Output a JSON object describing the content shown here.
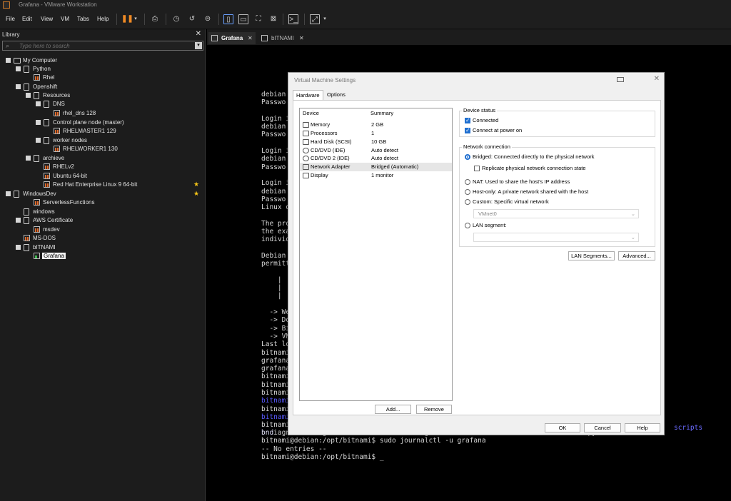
{
  "window": {
    "title": "Grafana - VMware Workstation"
  },
  "menu": [
    "File",
    "Edit",
    "View",
    "VM",
    "Tabs",
    "Help"
  ],
  "library": {
    "title": "Library",
    "search_placeholder": "Type here to search",
    "tree": [
      {
        "label": "My Computer"
      },
      {
        "label": "Python"
      },
      {
        "label": "Rhel"
      },
      {
        "label": "Openshift"
      },
      {
        "label": "Resources"
      },
      {
        "label": "DNS"
      },
      {
        "label": "rhel_dns 128"
      },
      {
        "label": "Control plane node (master)"
      },
      {
        "label": "RHELMASTER1 129"
      },
      {
        "label": "worker nodes"
      },
      {
        "label": "RHELWORKER1 130"
      },
      {
        "label": "archieve"
      },
      {
        "label": "RHELv2"
      },
      {
        "label": "Ubuntu 64-bit"
      },
      {
        "label": "Red Hat Enterprise Linux 9 64-bit"
      },
      {
        "label": "WindowsDev"
      },
      {
        "label": "ServerlessFunctions"
      },
      {
        "label": "windows"
      },
      {
        "label": "AWS Certificate"
      },
      {
        "label": "msdev"
      },
      {
        "label": "MS-DOS"
      },
      {
        "label": "bITNAMI"
      },
      {
        "label": "Grafana"
      }
    ]
  },
  "tabs": [
    {
      "label": "Grafana"
    },
    {
      "label": "bITNAMI"
    }
  ],
  "terminal": {
    "lines": [
      "debian",
      "Passwo",
      "",
      "Login i",
      "debian",
      "Passwo",
      "",
      "Login i",
      "debian",
      "Passwo",
      "",
      "Login i",
      "debian",
      "Passwo",
      "Linux d",
      "",
      "The pro",
      "the exa",
      "individ",
      "",
      "Debian",
      "permitt",
      "",
      "    |",
      "    |",
      "    |",
      "",
      "  -> We",
      "  -> Do",
      "  -> Bi",
      "  -> VM",
      "Last lo",
      "bitnami",
      "grafana",
      "grafana",
      "bitnami",
      "bitnami",
      "bitnami",
      "bitnami",
      "bitnami",
      "bitnami",
      "bitnami",
      "bnd"
    ],
    "tail": [
      "bndiagnostic-regex.ini   common         grafana        licenses         node    python",
      "bitnami@debian:/opt/bitnami$ sudo journalctl -u grafana",
      "-- No entries --",
      "bitnami@debian:/opt/bitnami$ _"
    ],
    "scripts_label": "scripts"
  },
  "dialog": {
    "title": "Virtual Machine Settings",
    "tabs": [
      "Hardware",
      "Options"
    ],
    "device_header": "Device",
    "summary_header": "Summary",
    "devices": [
      {
        "name": "Memory",
        "summary": "2 GB"
      },
      {
        "name": "Processors",
        "summary": "1"
      },
      {
        "name": "Hard Disk (SCSI)",
        "summary": "10 GB"
      },
      {
        "name": "CD/DVD (IDE)",
        "summary": "Auto detect"
      },
      {
        "name": "CD/DVD 2 (IDE)",
        "summary": "Auto detect"
      },
      {
        "name": "Network Adapter",
        "summary": "Bridged (Automatic)"
      },
      {
        "name": "Display",
        "summary": "1 monitor"
      }
    ],
    "add_label": "Add...",
    "remove_label": "Remove",
    "device_status": {
      "title": "Device status",
      "connected": "Connected",
      "connect_power": "Connect at power on"
    },
    "network": {
      "title": "Network connection",
      "bridged": "Bridged: Connected directly to the physical network",
      "replicate": "Replicate physical network connection state",
      "nat": "NAT: Used to share the host's IP address",
      "hostonly": "Host-only: A private network shared with the host",
      "custom": "Custom: Specific virtual network",
      "vmnet": "VMnet0",
      "lan": "LAN segment:",
      "lan_segments_btn": "LAN Segments...",
      "advanced_btn": "Advanced..."
    },
    "ok": "OK",
    "cancel": "Cancel",
    "help": "Help"
  }
}
